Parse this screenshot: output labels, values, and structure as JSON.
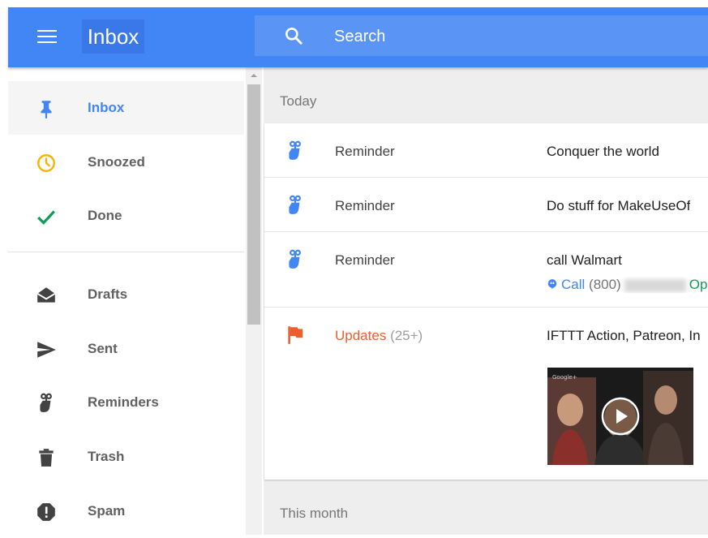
{
  "header": {
    "title": "Inbox",
    "search_placeholder": "Search",
    "color": "#4285f4"
  },
  "sidebar": {
    "items": [
      {
        "label": "Inbox",
        "icon": "pin-icon",
        "active": true
      },
      {
        "label": "Snoozed",
        "icon": "clock-icon"
      },
      {
        "label": "Done",
        "icon": "check-icon"
      },
      {
        "label": "Drafts",
        "icon": "drafts-icon"
      },
      {
        "label": "Sent",
        "icon": "send-icon"
      },
      {
        "label": "Reminders",
        "icon": "reminder-icon"
      },
      {
        "label": "Trash",
        "icon": "trash-icon"
      },
      {
        "label": "Spam",
        "icon": "spam-icon"
      }
    ]
  },
  "main": {
    "sections": [
      {
        "label": "Today"
      },
      {
        "label": "This month"
      }
    ],
    "rows": [
      {
        "sender": "Reminder",
        "subject": "Conquer the world",
        "icon": "reminder-icon"
      },
      {
        "sender": "Reminder",
        "subject": "Do stuff for MakeUseOf",
        "icon": "reminder-icon"
      },
      {
        "sender": "Reminder",
        "subject": "call Walmart",
        "icon": "reminder-icon",
        "call_label": "Call",
        "call_number": "(800)",
        "call_extra": "Op"
      },
      {
        "sender": "Updates",
        "count": "(25+)",
        "subject": "IFTTT Action, Patreon, In",
        "icon": "flag-icon"
      }
    ]
  },
  "colors": {
    "accent": "#4285f4",
    "snooze": "#f4b400",
    "done": "#0f9d58",
    "updates": "#ef5d2c"
  }
}
